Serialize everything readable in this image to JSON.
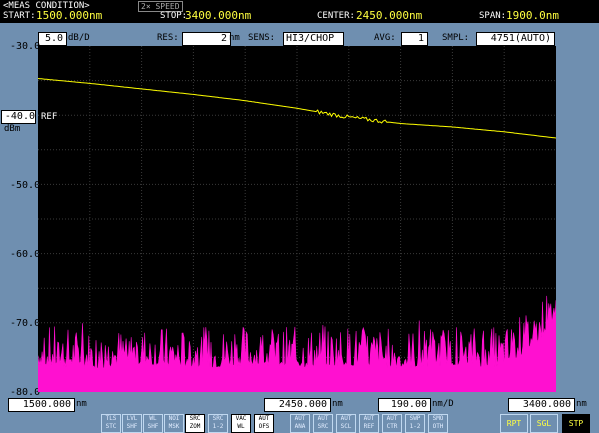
{
  "header": {
    "condition": "<MEAS CONDITION>",
    "tag": "2× SPEED",
    "start_label": "START:",
    "start_value": "1500.000nm",
    "stop_label": "STOP:",
    "stop_value": "3400.000nm",
    "center_label": "CENTER:",
    "center_value": "2450.000nm",
    "span_label": "SPAN:",
    "span_value": "1900.0nm"
  },
  "settings": {
    "scale_value": "5.0",
    "scale_unit": "dB/D",
    "res_label": "RES:",
    "res_value": "2",
    "res_unit": "nm",
    "sens_label": "SENS:",
    "sens_value": "HI3/CHOP",
    "avg_label": "AVG:",
    "avg_value": "1",
    "smpl_label": "SMPL:",
    "smpl_value": "4751(AUTO)"
  },
  "axis": {
    "y_ticks": [
      "-30.0",
      "-50.0",
      "-60.0",
      "-70.0",
      "-80.0"
    ],
    "ref_value": "-40.0",
    "ref_label": "REF",
    "ref_unit": "dBm"
  },
  "bottom": {
    "start_value": "1500.000",
    "start_unit": "nm",
    "center_value": "2450.000",
    "center_unit": "nm",
    "div_value": "190.00",
    "div_unit": "nm/D",
    "stop_value": "3400.000",
    "stop_unit": "nm"
  },
  "keys": [
    {
      "l1": "TLS",
      "l2": "STC"
    },
    {
      "l1": "LVL",
      "l2": "SHF"
    },
    {
      "l1": "WL",
      "l2": "SHF"
    },
    {
      "l1": "NOI",
      "l2": "MSK"
    },
    {
      "l1": "SRC",
      "l2": "ZOM"
    },
    {
      "l1": "SRC",
      "l2": "1-2"
    },
    {
      "l1": "VAC",
      "l2": "WL"
    },
    {
      "l1": "AUT",
      "l2": "OFS"
    },
    {
      "l1": "AUT",
      "l2": "ANA"
    },
    {
      "l1": "AUT",
      "l2": "SRC"
    },
    {
      "l1": "AUT",
      "l2": "SCL"
    },
    {
      "l1": "AUT",
      "l2": "REF"
    },
    {
      "l1": "AUT",
      "l2": "CTR"
    },
    {
      "l1": "SWP",
      "l2": "1-2"
    },
    {
      "l1": "SMO",
      "l2": "OTH"
    }
  ],
  "softkeys": {
    "rpt": "RPT",
    "sgl": "SGL",
    "stp": "STP"
  },
  "colors": {
    "trace_a": "#ffff00",
    "trace_b": "#ff10d0",
    "grid": "#3a3a3a",
    "value": "#ffff40"
  },
  "chart_data": {
    "type": "line",
    "x_range_nm": [
      1500,
      3400
    ],
    "y_range_dbm": [
      -80,
      -30
    ],
    "series": [
      {
        "x": [
          1500,
          1690,
          1880,
          2070,
          2260,
          2450,
          2640,
          2830,
          3020,
          3210,
          3400
        ],
        "y": [
          -34.7,
          -35.4,
          -36.2,
          -37.0,
          -37.9,
          -39.0,
          -40.3,
          -41.2,
          -41.7,
          -42.4,
          -43.3
        ]
      },
      {
        "x": [
          1500,
          1690,
          1880,
          2070,
          2260,
          2450,
          2640,
          2830,
          3020,
          3210,
          3290,
          3350,
          3400
        ],
        "y": [
          -75,
          -75.5,
          -75,
          -75.5,
          -75,
          -75.3,
          -75,
          -75.5,
          -75,
          -75.3,
          -73,
          -71,
          -68
        ]
      }
    ]
  }
}
